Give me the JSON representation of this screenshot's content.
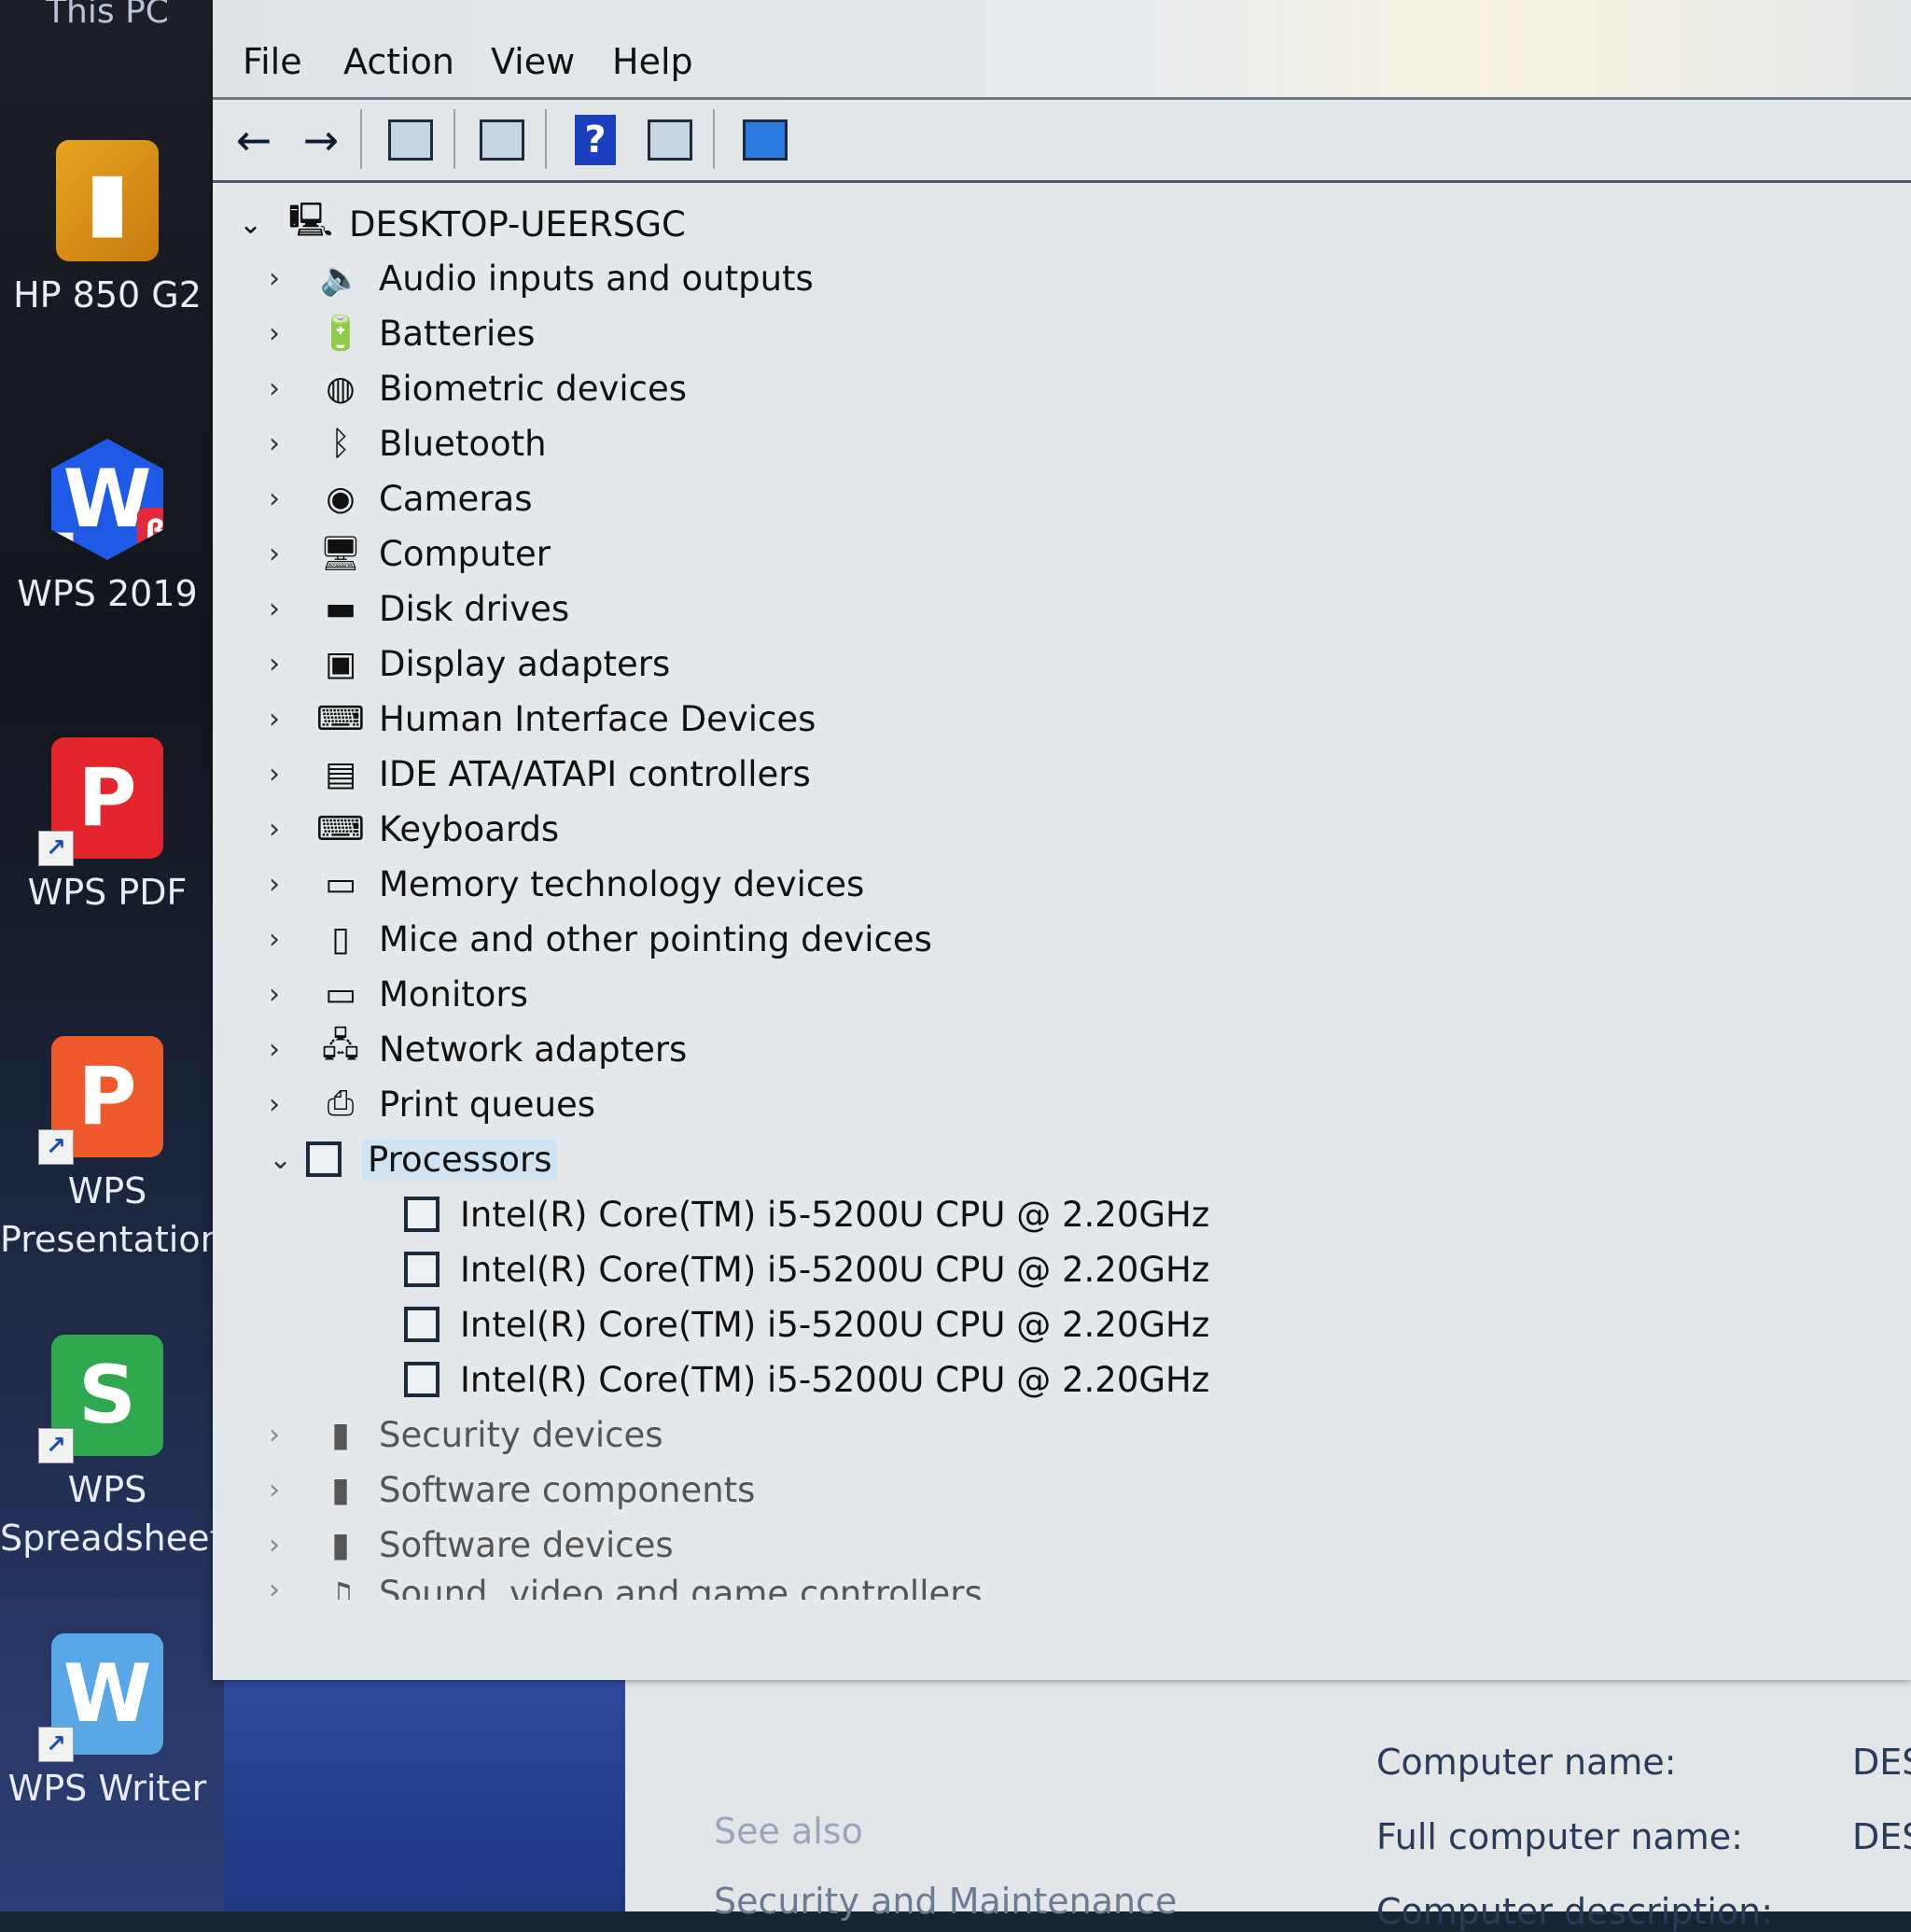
{
  "desktop": {
    "top_partial_label": "This PC",
    "icons": [
      {
        "label": "HP 850 G2",
        "glyph": "folder-icon"
      },
      {
        "label": "WPS 2019",
        "glyph": "W",
        "badge": "β"
      },
      {
        "label": "WPS PDF",
        "glyph": "P"
      },
      {
        "label": "WPS\nPresentation",
        "glyph": "P"
      },
      {
        "label": "WPS\nSpreadsheets",
        "glyph": "S"
      },
      {
        "label": "WPS Writer",
        "glyph": "W"
      }
    ]
  },
  "window": {
    "menu": [
      "File",
      "Action",
      "View",
      "Help"
    ],
    "toolbar": {
      "back": "←",
      "forward": "→",
      "help": "?"
    },
    "tree": {
      "root": "DESKTOP-UEERSGC",
      "categories": [
        {
          "label": "Audio inputs and outputs",
          "icon": "speaker-icon",
          "glyph": "🔈"
        },
        {
          "label": "Batteries",
          "icon": "battery-icon",
          "glyph": "🔋"
        },
        {
          "label": "Biometric devices",
          "icon": "fingerprint-icon",
          "glyph": "◍"
        },
        {
          "label": "Bluetooth",
          "icon": "bluetooth-icon",
          "glyph": "ᛒ"
        },
        {
          "label": "Cameras",
          "icon": "camera-icon",
          "glyph": "◉"
        },
        {
          "label": "Computer",
          "icon": "computer-icon",
          "glyph": "🖥"
        },
        {
          "label": "Disk drives",
          "icon": "disk-drive-icon",
          "glyph": "▬"
        },
        {
          "label": "Display adapters",
          "icon": "display-adapter-icon",
          "glyph": "▣"
        },
        {
          "label": "Human Interface Devices",
          "icon": "hid-icon",
          "glyph": "⌨"
        },
        {
          "label": "IDE ATA/ATAPI controllers",
          "icon": "ide-controller-icon",
          "glyph": "▤"
        },
        {
          "label": "Keyboards",
          "icon": "keyboard-icon",
          "glyph": "⌨"
        },
        {
          "label": "Memory technology devices",
          "icon": "memory-icon",
          "glyph": "▭"
        },
        {
          "label": "Mice and other pointing devices",
          "icon": "mouse-icon",
          "glyph": "▯"
        },
        {
          "label": "Monitors",
          "icon": "monitor-icon",
          "glyph": "▭"
        },
        {
          "label": "Network adapters",
          "icon": "network-icon",
          "glyph": "🖧"
        },
        {
          "label": "Print queues",
          "icon": "printer-icon",
          "glyph": "⎙"
        }
      ],
      "processors": {
        "label": "Processors",
        "children": [
          "Intel(R) Core(TM) i5-5200U CPU @ 2.20GHz",
          "Intel(R) Core(TM) i5-5200U CPU @ 2.20GHz",
          "Intel(R) Core(TM) i5-5200U CPU @ 2.20GHz",
          "Intel(R) Core(TM) i5-5200U CPU @ 2.20GHz"
        ]
      },
      "after": [
        {
          "label": "Security devices",
          "icon": "security-icon",
          "glyph": "▮"
        },
        {
          "label": "Software components",
          "icon": "software-component-icon",
          "glyph": "▮"
        },
        {
          "label": "Software devices",
          "icon": "software-device-icon",
          "glyph": "▮"
        },
        {
          "label": "Sound, video and game controllers",
          "icon": "sound-icon",
          "glyph": "♫"
        }
      ]
    }
  },
  "background_panel": {
    "see_also": "See also",
    "security": "Security and Maintenance",
    "computer_name_label": "Computer name:",
    "computer_name_value": "DES",
    "full_name_label": "Full computer name:",
    "full_name_value": "DES",
    "description_label": "Computer description:"
  }
}
